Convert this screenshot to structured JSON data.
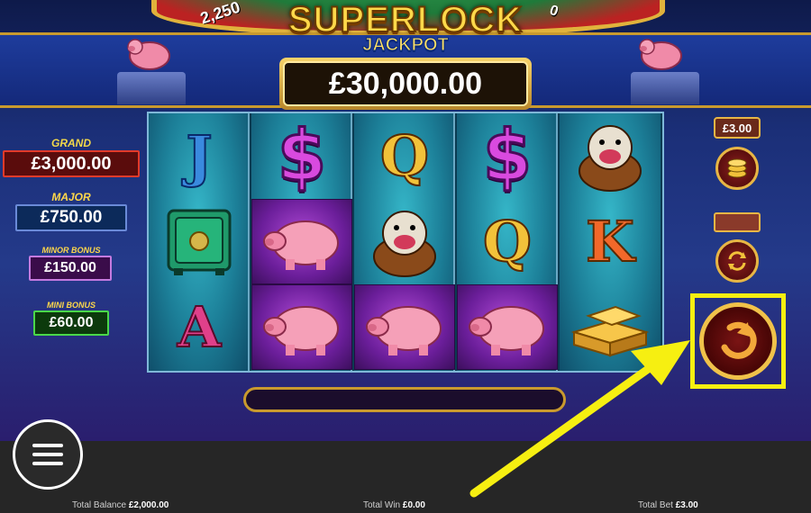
{
  "logo": {
    "title": "SUPERLOCK",
    "subtitle": "JACKPOT"
  },
  "jackpot_main": "£30,000.00",
  "wheel_values": {
    "left": "2,250",
    "right": "0"
  },
  "jackpots": [
    {
      "label": "GRAND",
      "value": "£3,000.00",
      "label_color": "#f2d84a",
      "border": "#e23a2a",
      "bg": "#5a0c0c"
    },
    {
      "label": "MAJOR",
      "value": "£750.00",
      "label_color": "#ffd84a",
      "border": "#6a8ad8",
      "bg": "#0c2a5a"
    },
    {
      "label": "MINOR BONUS",
      "value": "£150.00",
      "label_color": "#ffd84a",
      "border": "#c47adf",
      "bg": "#3a0c4a"
    },
    {
      "label": "MINI BONUS",
      "value": "£60.00",
      "label_color": "#ffd84a",
      "border": "#4ad84a",
      "bg": "#0c3a0c"
    }
  ],
  "reels": [
    [
      "J",
      "safe",
      "A"
    ],
    [
      "$",
      "pig",
      "pig"
    ],
    [
      "Q",
      "bulldog",
      "pig"
    ],
    [
      "$",
      "Q",
      "pig"
    ],
    [
      "bulldog",
      "K",
      "gold-bars"
    ]
  ],
  "controls": {
    "bet_value": "£3.00"
  },
  "footer": {
    "balance_label": "Total Balance",
    "balance_value": "£2,000.00",
    "win_label": "Total Win",
    "win_value": "£0.00",
    "bet_label": "Total Bet",
    "bet_value": "£3.00"
  },
  "colors": {
    "highlight": "#f6ef11",
    "gold": "#e7b645"
  }
}
